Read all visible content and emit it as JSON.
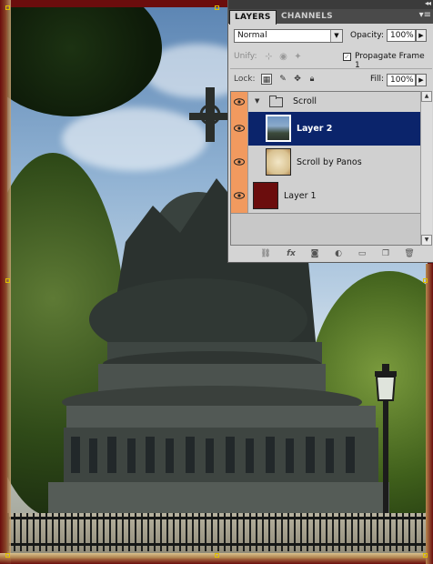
{
  "panel": {
    "tabs": [
      {
        "label": "LAYERS",
        "active": true
      },
      {
        "label": "CHANNELS",
        "active": false
      }
    ],
    "blend_mode": "Normal",
    "opacity_label": "Opacity:",
    "opacity_value": "100%",
    "unify_label": "Unify:",
    "propagate_label": "Propagate Frame 1",
    "propagate_checked": true,
    "lock_label": "Lock:",
    "fill_label": "Fill:",
    "fill_value": "100%",
    "layers": [
      {
        "name": "Scroll",
        "kind": "group",
        "visible": true,
        "selected": false
      },
      {
        "name": "Layer 2",
        "kind": "image",
        "visible": true,
        "selected": true
      },
      {
        "name": "Scroll by Panos",
        "kind": "image",
        "visible": true,
        "selected": false
      },
      {
        "name": "Layer 1",
        "kind": "fill",
        "visible": true,
        "selected": false,
        "color": "#6b0d0d"
      }
    ],
    "footer_icons": [
      "link-icon",
      "fx-icon",
      "mask-icon",
      "adjustment-icon",
      "new-group-icon",
      "new-layer-icon",
      "trash-icon"
    ]
  },
  "colors": {
    "selection": "#0b246b",
    "eye_column": "#f19a5f",
    "frame": "#6b0d0d"
  }
}
